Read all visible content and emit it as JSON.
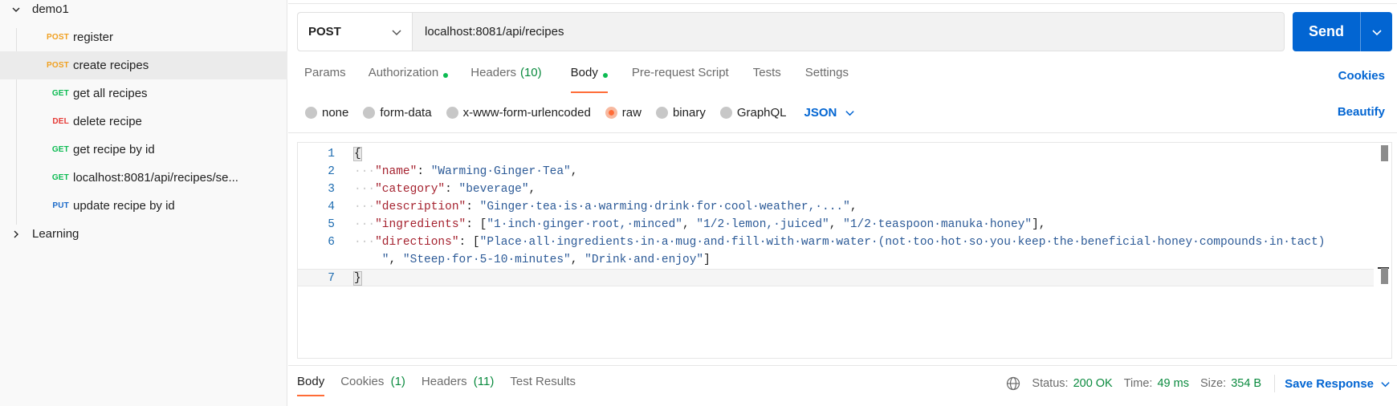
{
  "sidebar": {
    "folders": [
      {
        "label": "demo1",
        "expanded": true
      },
      {
        "label": "Learning",
        "expanded": false
      }
    ],
    "requests": [
      {
        "method": "POST",
        "label": "register",
        "method_color": "#f0a020",
        "selected": false
      },
      {
        "method": "POST",
        "label": "create recipes",
        "method_color": "#f0a020",
        "selected": true
      },
      {
        "method": "GET",
        "label": "get all recipes",
        "method_color": "#0cbb52",
        "selected": false
      },
      {
        "method": "DEL",
        "label": "delete recipe",
        "method_color": "#e53935",
        "selected": false
      },
      {
        "method": "GET",
        "label": "get recipe by id",
        "method_color": "#0cbb52",
        "selected": false
      },
      {
        "method": "GET",
        "label": "localhost:8081/api/recipes/se...",
        "method_color": "#0cbb52",
        "selected": false
      },
      {
        "method": "PUT",
        "label": "update recipe by id",
        "method_color": "#1b6ac9",
        "selected": false
      }
    ]
  },
  "request": {
    "method": "POST",
    "url": "localhost:8081/api/recipes",
    "send_label": "Send"
  },
  "tabs": [
    {
      "label": "Params",
      "count": "",
      "dot": false,
      "active": false
    },
    {
      "label": "Authorization",
      "count": "",
      "dot": true,
      "active": false
    },
    {
      "label": "Headers",
      "count": "(10)",
      "dot": false,
      "active": false
    },
    {
      "label": "Body",
      "count": "",
      "dot": true,
      "active": true
    },
    {
      "label": "Pre-request Script",
      "count": "",
      "dot": false,
      "active": false
    },
    {
      "label": "Tests",
      "count": "",
      "dot": false,
      "active": false
    },
    {
      "label": "Settings",
      "count": "",
      "dot": false,
      "active": false
    }
  ],
  "cookies_label": "Cookies",
  "body_types": [
    {
      "label": "none",
      "checked": false
    },
    {
      "label": "form-data",
      "checked": false
    },
    {
      "label": "x-www-form-urlencoded",
      "checked": false
    },
    {
      "label": "raw",
      "checked": true
    },
    {
      "label": "binary",
      "checked": false
    },
    {
      "label": "GraphQL",
      "checked": false
    }
  ],
  "format_label": "JSON",
  "beautify_label": "Beautify",
  "code_lines": [
    {
      "num": "1",
      "tokens": [
        [
          "brace",
          "{"
        ]
      ]
    },
    {
      "num": "2",
      "tokens": [
        [
          "ws",
          "···"
        ],
        [
          "key",
          "\"name\""
        ],
        [
          "punc",
          ": "
        ],
        [
          "str",
          "\"Warming·Ginger·Tea\""
        ],
        [
          "punc",
          ","
        ]
      ]
    },
    {
      "num": "3",
      "tokens": [
        [
          "ws",
          "···"
        ],
        [
          "key",
          "\"category\""
        ],
        [
          "punc",
          ": "
        ],
        [
          "str",
          "\"beverage\""
        ],
        [
          "punc",
          ","
        ]
      ]
    },
    {
      "num": "4",
      "tokens": [
        [
          "ws",
          "···"
        ],
        [
          "key",
          "\"description\""
        ],
        [
          "punc",
          ": "
        ],
        [
          "str",
          "\"Ginger·tea·is·a·warming·drink·for·cool·weather,·...\""
        ],
        [
          "punc",
          ","
        ]
      ]
    },
    {
      "num": "5",
      "tokens": [
        [
          "ws",
          "···"
        ],
        [
          "key",
          "\"ingredients\""
        ],
        [
          "punc",
          ": ["
        ],
        [
          "str",
          "\"1·inch·ginger·root,·minced\""
        ],
        [
          "punc",
          ", "
        ],
        [
          "str",
          "\"1/2·lemon,·juiced\""
        ],
        [
          "punc",
          ", "
        ],
        [
          "str",
          "\"1/2·teaspoon·manuka·honey\""
        ],
        [
          "punc",
          "],"
        ]
      ]
    },
    {
      "num": "6",
      "tokens": [
        [
          "ws",
          "···"
        ],
        [
          "key",
          "\"directions\""
        ],
        [
          "punc",
          ": ["
        ],
        [
          "str",
          "\"Place·all·ingredients·in·a·mug·and·fill·with·warm·water·(not·too·hot·so·you·keep·the·beneficial·honey·compounds·in·tact)"
        ]
      ]
    },
    {
      "num": "",
      "tokens": [
        [
          "str",
          "    \""
        ],
        [
          "punc",
          ", "
        ],
        [
          "str",
          "\"Steep·for·5-10·minutes\""
        ],
        [
          "punc",
          ", "
        ],
        [
          "str",
          "\"Drink·and·enjoy\""
        ],
        [
          "punc",
          "]"
        ]
      ]
    },
    {
      "num": "7",
      "tokens": [
        [
          "brace",
          "}"
        ]
      ]
    }
  ],
  "response": {
    "tabs": [
      {
        "label": "Body",
        "count": "",
        "active": true
      },
      {
        "label": "Cookies",
        "count": "(1)",
        "active": false
      },
      {
        "label": "Headers",
        "count": "(11)",
        "active": false
      },
      {
        "label": "Test Results",
        "count": "",
        "active": false
      }
    ],
    "status_label": "Status:",
    "status_value": "200 OK",
    "time_label": "Time:",
    "time_value": "49 ms",
    "size_label": "Size:",
    "size_value": "354 B",
    "save_label": "Save Response"
  },
  "colors": {
    "accent_orange": "#ff6c37",
    "send_blue": "#0265d2",
    "status_green": "#0a8a3e"
  }
}
